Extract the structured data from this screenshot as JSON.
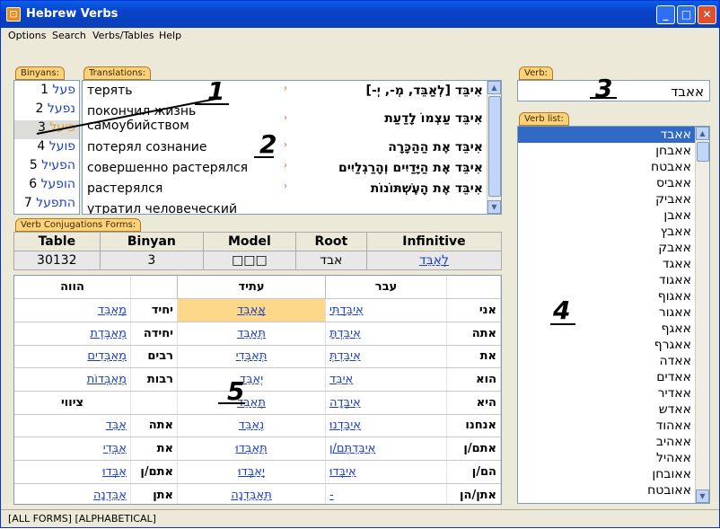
{
  "window": {
    "title": "Hebrew Verbs",
    "buttons": [
      "_",
      "□",
      "✕"
    ]
  },
  "menu": [
    "Options",
    "Search",
    "Verbs/Tables",
    "Help"
  ],
  "binyans": {
    "tab": "Binyans:",
    "items": [
      {
        "num": "1",
        "label": "פעל"
      },
      {
        "num": "2",
        "label": "נפעל"
      },
      {
        "num": "3",
        "label": "פיעל"
      },
      {
        "num": "4",
        "label": "פועל"
      },
      {
        "num": "5",
        "label": "הפעיל"
      },
      {
        "num": "6",
        "label": "הופעל"
      },
      {
        "num": "7",
        "label": "התפעל"
      }
    ]
  },
  "translations": {
    "tab": "Translations:",
    "rows": [
      {
        "ru": "терять",
        "he": "אִיבֵּד [לְאַבֵּד, מְ-, יְ-]"
      },
      {
        "ru": "покончил жизнь самоубийством",
        "he": "אִיבֵּד עַצְמוֹ לָדַעַת"
      },
      {
        "ru": "потерял сознание",
        "he": "אִיבֵּד אֶת הַהַכָּרָה"
      },
      {
        "ru": "совершенно растерялся",
        "he": "אִיבֵּד אֶת הַיָּדַיִים וְהָרַגְלַיִים"
      },
      {
        "ru": "растерялся",
        "he": "אִיבֵּד אֶת הָעֶשְׁתּוֹנוֹת"
      },
      {
        "ru": "утратил человеческий",
        "he": ""
      }
    ]
  },
  "verb": {
    "tab": "Verb:",
    "value": "אאבד"
  },
  "verb_list": {
    "tab": "Verb list:",
    "items": [
      "אאבד",
      "אאבחן",
      "אאבטח",
      "אאביס",
      "אאביק",
      "אאבן",
      "אאבץ",
      "אאבק",
      "אאגד",
      "אאגוד",
      "אאגוף",
      "אאגור",
      "אאגף",
      "אאגרף",
      "אאדה",
      "אאדים",
      "אאדיר",
      "אאדש",
      "אאהוד",
      "אאהיב",
      "אאהיל",
      "אאובחן",
      "אאובטח"
    ]
  },
  "conj": {
    "tab": "Verb Conjugations Forms:",
    "headers": [
      "Table",
      "Binyan",
      "Model",
      "Root",
      "Infinitive"
    ],
    "values": [
      "30132",
      "3",
      "□□□",
      "אבד",
      "לְאַבֵּד"
    ],
    "col_headers": {
      "present": "הווה",
      "future": "עתיד",
      "past": "עבר",
      "imperative": "ציווי"
    },
    "rows": [
      {
        "p_form": "מְאַבֵּד",
        "p_pron": "יחיד",
        "f_form": "אֲאַבֵּד",
        "past_form": "אִיבַּדְתִּי",
        "past_pron": "אני"
      },
      {
        "p_form": "מְאַבֶּדֶת",
        "p_pron": "יחידה",
        "f_form": "תְּאַבֵּד",
        "past_form": "אִיבַּדְתָּ",
        "past_pron": "אתה"
      },
      {
        "p_form": "מְאַבְּדִים",
        "p_pron": "רבים",
        "f_form": "תְּאַבְּדִי",
        "past_form": "אִיבַּדְתְּ",
        "past_pron": "את"
      },
      {
        "p_form": "מְאַבְּדוֹת",
        "p_pron": "רבות",
        "f_form": "יְאַבֵּד",
        "past_form": "אִיבֵּד",
        "past_pron": "הוא"
      },
      {
        "p_form": "",
        "p_pron": "",
        "f_form": "תְּאַבֵּד",
        "past_form": "אִיבְּדָה",
        "past_pron": "היא"
      },
      {
        "p_form": "אַבֵּד",
        "p_pron": "אתה",
        "f_form": "נְאַבֵּד",
        "past_form": "אִיבַּדְנוּ",
        "past_pron": "אנחנו"
      },
      {
        "p_form": "אַבְּדִי",
        "p_pron": "את",
        "f_form": "תְּאַבְּדוּ",
        "past_form": "אִיבַּדְתֶּם/ן",
        "past_pron": "אתם/ן"
      },
      {
        "p_form": "אַבְּדוּ",
        "p_pron": "אתם/ן",
        "f_form": "יְאַבְּדוּ",
        "past_form": "אִיבְּדוּ",
        "past_pron": "הם/ן"
      },
      {
        "p_form": "אַבֵּדְנָה",
        "p_pron": "אתן",
        "f_form": "תְּאַבֵּדְנָה",
        "past_form": "-",
        "past_pron": "אתן/הן"
      }
    ]
  },
  "annotations": [
    "1",
    "2",
    "3",
    "4",
    "5"
  ],
  "status": "[ALL FORMS] [ALPHABETICAL]",
  "colors": {
    "title_bar": "#0a4fd8",
    "tab": "#fdd27a",
    "highlight": "#fdd88a",
    "selection": "#316ac5",
    "link": "#1a3fc0"
  }
}
